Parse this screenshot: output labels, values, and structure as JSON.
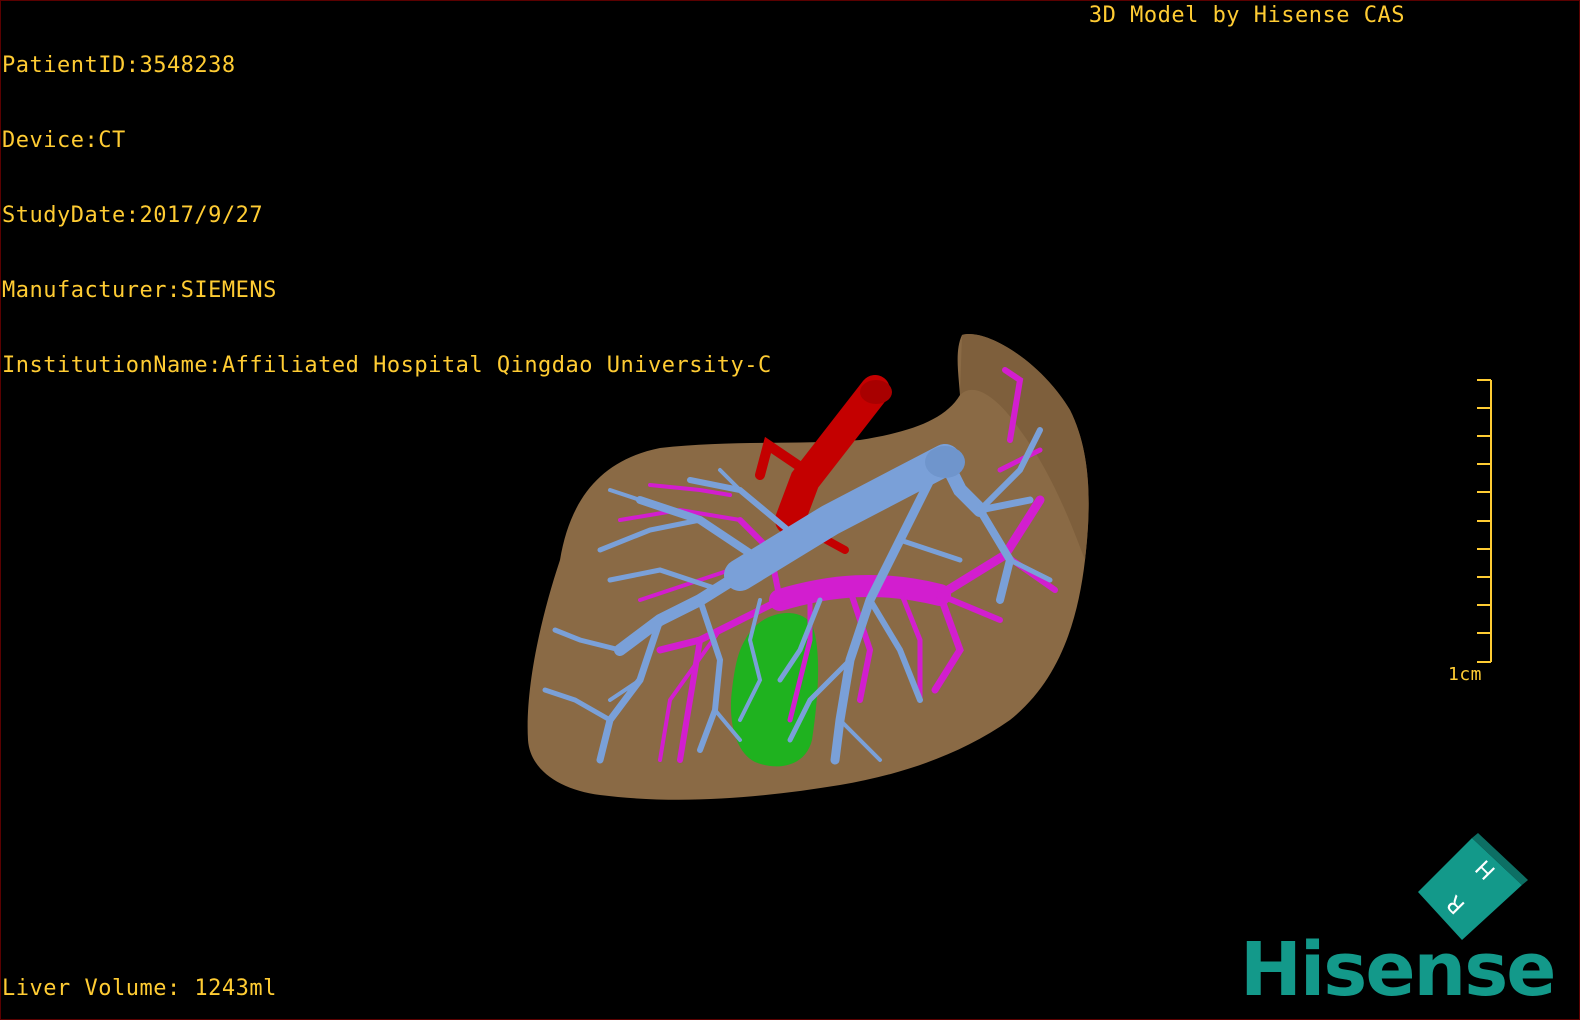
{
  "overlay": {
    "patient_id": "PatientID:3548238",
    "device": "Device:CT",
    "study_date": "StudyDate:2017/9/27",
    "manufacturer": "Manufacturer:SIEMENS",
    "institution": "InstitutionName:Affiliated Hospital Qingdao University-C",
    "title": "3D Model by Hisense CAS",
    "liver_volume": "Liver Volume: 1243ml"
  },
  "scale_bar": {
    "label": "1cm"
  },
  "orientation_cube": {
    "labels": [
      "H",
      "R"
    ]
  },
  "logo": {
    "text": "Hisense"
  },
  "colors": {
    "overlay_text": "#ffcc33",
    "liver": "#8a6a45",
    "portal_vein": "#7aa0d8",
    "hepatic_vein": "#d21ecf",
    "artery": "#c40000",
    "gallbladder": "#1fb21f",
    "logo": "#13998a",
    "scale_bar": "#ffcc33"
  }
}
